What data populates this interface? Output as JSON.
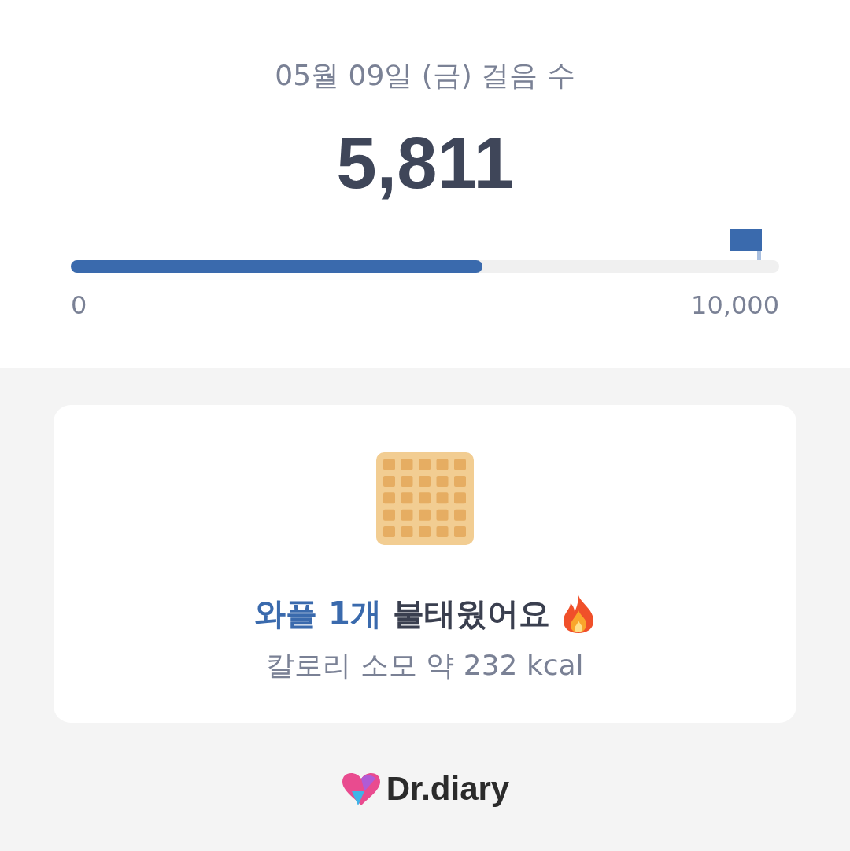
{
  "header": {
    "title": "05월 09일 (금) 걸음 수",
    "steps": "5,811"
  },
  "progress": {
    "level": 0.5811,
    "min_label": "0",
    "max_label": "10,000"
  },
  "card": {
    "headline": "**와플 1개** 불태웠어요",
    "calories": "칼로리 소모 약 232 kcal"
  },
  "footer": {
    "brand": "Dr.diary"
  }
}
